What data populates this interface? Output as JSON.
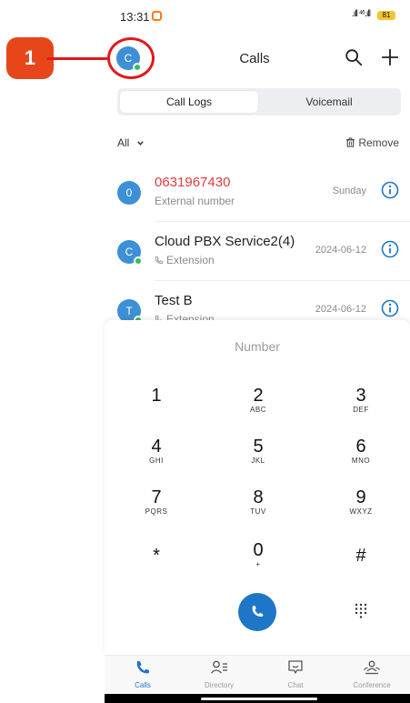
{
  "status_bar": {
    "time": "13:31",
    "signal": ".ıll ⁴⁶.ıll",
    "battery": "81"
  },
  "callout": {
    "number": "1"
  },
  "header": {
    "avatar_initial": "C",
    "title": "Calls"
  },
  "segmented": {
    "call_logs": "Call Logs",
    "voicemail": "Voicemail"
  },
  "filter": {
    "label": "All",
    "remove": "Remove"
  },
  "calls": [
    {
      "initial": "0",
      "name": "0631967430",
      "sub": "External number",
      "date": "Sunday",
      "missed": true,
      "presence": false
    },
    {
      "initial": "C",
      "name": "Cloud PBX Service2(4)",
      "sub": "Extension",
      "date": "2024-06-12",
      "missed": false,
      "presence": true
    },
    {
      "initial": "T",
      "name": "Test B",
      "sub": "Extension",
      "date": "2024-06-12",
      "missed": false,
      "presence": true
    }
  ],
  "dialpad": {
    "placeholder": "Number",
    "keys": [
      {
        "digit": "1",
        "letters": ""
      },
      {
        "digit": "2",
        "letters": "ABC"
      },
      {
        "digit": "3",
        "letters": "DEF"
      },
      {
        "digit": "4",
        "letters": "GHI"
      },
      {
        "digit": "5",
        "letters": "JKL"
      },
      {
        "digit": "6",
        "letters": "MNO"
      },
      {
        "digit": "7",
        "letters": "PQRS"
      },
      {
        "digit": "8",
        "letters": "TUV"
      },
      {
        "digit": "9",
        "letters": "WXYZ"
      },
      {
        "digit": "*",
        "letters": ""
      },
      {
        "digit": "0",
        "letters": "+"
      },
      {
        "digit": "#",
        "letters": ""
      }
    ]
  },
  "bottom_nav": {
    "items": [
      {
        "label": "Calls",
        "icon": "phone-icon",
        "active": true
      },
      {
        "label": "Directory",
        "icon": "directory-icon",
        "active": false
      },
      {
        "label": "Chat",
        "icon": "chat-icon",
        "active": false
      },
      {
        "label": "Conference",
        "icon": "conference-icon",
        "active": false
      }
    ]
  },
  "colors": {
    "accent": "#1e76c8",
    "missed": "#e33b3b",
    "avatar": "#3d90d6",
    "presence": "#2ebf5a",
    "callout": "#e6461a"
  }
}
